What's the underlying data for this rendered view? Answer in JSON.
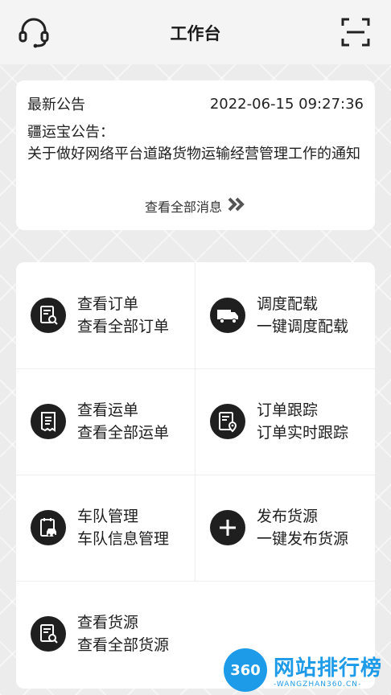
{
  "header": {
    "title": "工作台",
    "left_icon": "headset-icon",
    "right_icon": "scan-icon"
  },
  "notice": {
    "label": "最新公告",
    "time": "2022-06-15 09:27:36",
    "heading": "疆运宝公告：",
    "body": "关于做好网络平台道路货物运输经营管理工作的通知",
    "view_all": "查看全部消息"
  },
  "menu": [
    {
      "title": "查看订单",
      "subtitle": "查看全部订单",
      "icon": "order-search-icon"
    },
    {
      "title": "调度配载",
      "subtitle": "一键调度配载",
      "icon": "truck-icon"
    },
    {
      "title": "查看运单",
      "subtitle": "查看全部运单",
      "icon": "waybill-icon"
    },
    {
      "title": "订单跟踪",
      "subtitle": "订单实时跟踪",
      "icon": "order-track-icon"
    },
    {
      "title": "车队管理",
      "subtitle": "车队信息管理",
      "icon": "fleet-icon"
    },
    {
      "title": "发布货源",
      "subtitle": "一键发布货源",
      "icon": "plus-icon"
    },
    {
      "title": "查看货源",
      "subtitle": "查看全部货源",
      "icon": "cargo-search-icon"
    }
  ],
  "watermark": {
    "badge": "360",
    "text": "网站排行榜",
    "sub": "-WANGZHAN360.CN-"
  },
  "colors": {
    "icon_bg": "#1f1f1f",
    "watermark": "#1e9be8"
  }
}
